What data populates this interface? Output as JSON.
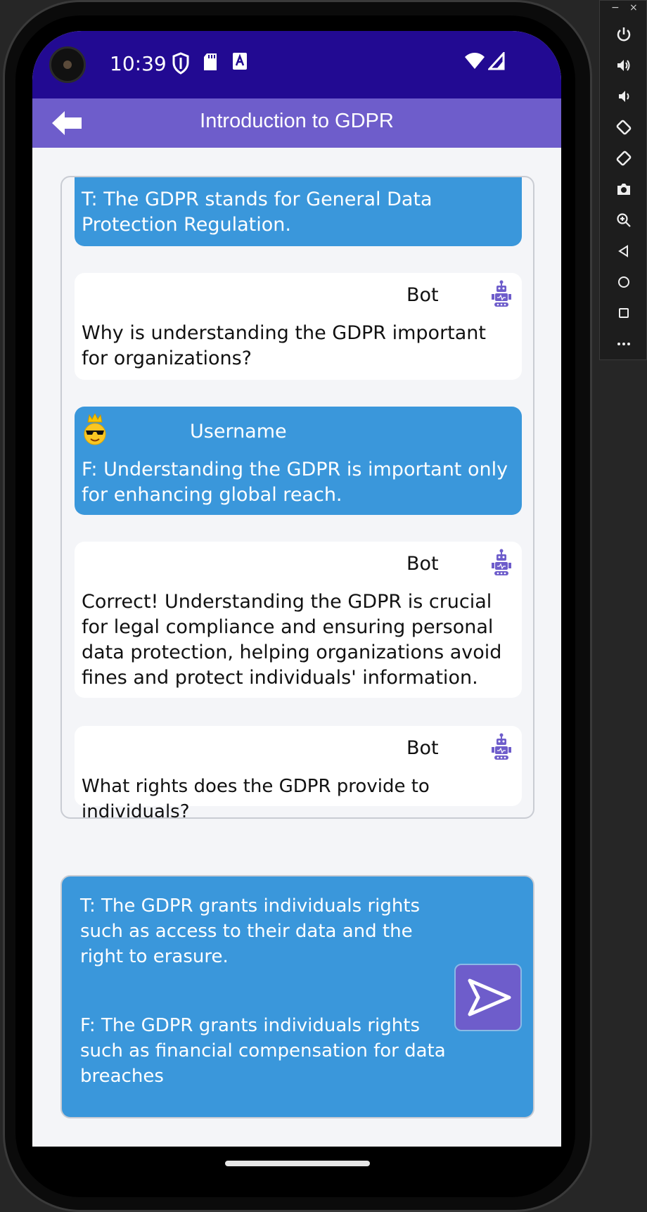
{
  "status_bar": {
    "time": "10:39"
  },
  "app_bar": {
    "title": "Introduction to GDPR"
  },
  "messages": [
    {
      "kind": "user",
      "text": "T: The GDPR stands for General Data Protection Regulation."
    },
    {
      "kind": "bot",
      "sender": "Bot",
      "text": "Why is understanding the GDPR important for organizations?"
    },
    {
      "kind": "user",
      "sender": "Username",
      "text": "F: Understanding the GDPR is important only for enhancing global reach."
    },
    {
      "kind": "bot",
      "sender": "Bot",
      "text": "Correct! Understanding the GDPR is crucial for legal compliance and ensuring personal data protection, helping organizations avoid fines and protect individuals' information."
    },
    {
      "kind": "bot",
      "sender": "Bot",
      "text": "What rights does the GDPR provide to individuals?"
    }
  ],
  "answer_options": [
    "T: The GDPR grants individuals rights such as access to their data and the right to erasure.",
    "F: The GDPR grants individuals rights such as financial compensation for data breaches"
  ],
  "side_panel": {
    "window_controls": [
      "−",
      "×"
    ],
    "buttons": [
      "power-icon",
      "volume-up-icon",
      "volume-down-icon",
      "rotate-left-icon",
      "rotate-right-icon",
      "camera-icon",
      "zoom-icon",
      "back-icon",
      "home-icon",
      "overview-icon",
      "more-icon"
    ]
  },
  "colors": {
    "status_bar": "#220a92",
    "app_bar": "#6e5dcb",
    "user_bubble": "#3a97db",
    "bot_bubble": "#ffffff",
    "accent": "#6e5dcb"
  }
}
